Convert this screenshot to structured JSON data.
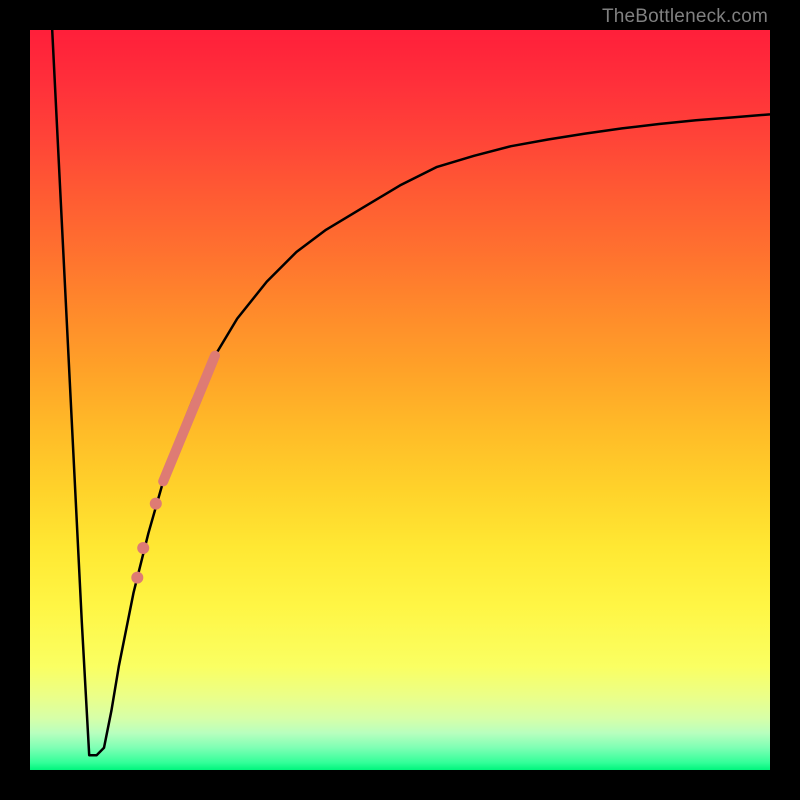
{
  "watermark": "TheBottleneck.com",
  "chart_data": {
    "type": "line",
    "title": "",
    "xlabel": "",
    "ylabel": "",
    "xlim": [
      0,
      100
    ],
    "ylim": [
      0,
      100
    ],
    "grid": false,
    "legend": false,
    "background": "gradient-red-to-green-vertical",
    "series": [
      {
        "name": "bottleneck-curve",
        "color": "#000000",
        "x": [
          3.0,
          4.0,
          5.0,
          6.0,
          7.0,
          8.0,
          9.0,
          10.0,
          11.0,
          12.0,
          14.0,
          16.0,
          18.0,
          20.0,
          22.0,
          25.0,
          28.0,
          32.0,
          36.0,
          40.0,
          45.0,
          50.0,
          55.0,
          60.0,
          65.0,
          70.0,
          75.0,
          80.0,
          85.0,
          90.0,
          95.0,
          100.0
        ],
        "y": [
          100,
          80,
          60,
          40,
          20,
          2,
          2,
          3,
          8,
          14,
          24,
          32,
          39,
          45,
          50,
          56,
          61,
          66,
          70,
          73,
          76,
          79,
          81.5,
          83,
          84.3,
          85.2,
          86,
          86.7,
          87.3,
          87.8,
          88.2,
          88.6
        ]
      }
    ],
    "markers": [
      {
        "name": "highlight-segment",
        "type": "line-segment",
        "color": "#de7b74",
        "width": 10,
        "x": [
          18.0,
          25.0
        ],
        "y": [
          39,
          56
        ]
      },
      {
        "name": "dot-marker-1",
        "type": "dot",
        "color": "#de7b74",
        "radius": 6,
        "x": 17.0,
        "y": 36
      },
      {
        "name": "dot-marker-2",
        "type": "dot",
        "color": "#de7b74",
        "radius": 6,
        "x": 15.3,
        "y": 30
      },
      {
        "name": "dot-marker-3",
        "type": "dot",
        "color": "#de7b74",
        "radius": 6,
        "x": 14.5,
        "y": 26
      }
    ]
  }
}
